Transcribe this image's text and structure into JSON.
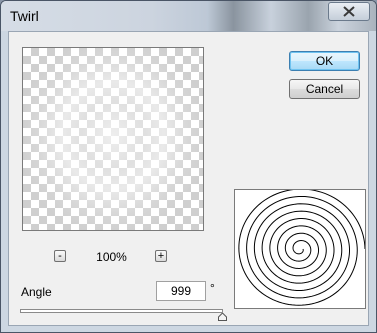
{
  "window": {
    "title": "Twirl"
  },
  "preview": {
    "zoom_level": "100%",
    "zoom_out_label": "-",
    "zoom_in_label": "+"
  },
  "buttons": {
    "ok_label": "OK",
    "cancel_label": "Cancel"
  },
  "angle": {
    "label": "Angle",
    "value": "999",
    "unit": "°",
    "slider_fraction": 1.0
  },
  "icons": {
    "close": "close-icon"
  }
}
